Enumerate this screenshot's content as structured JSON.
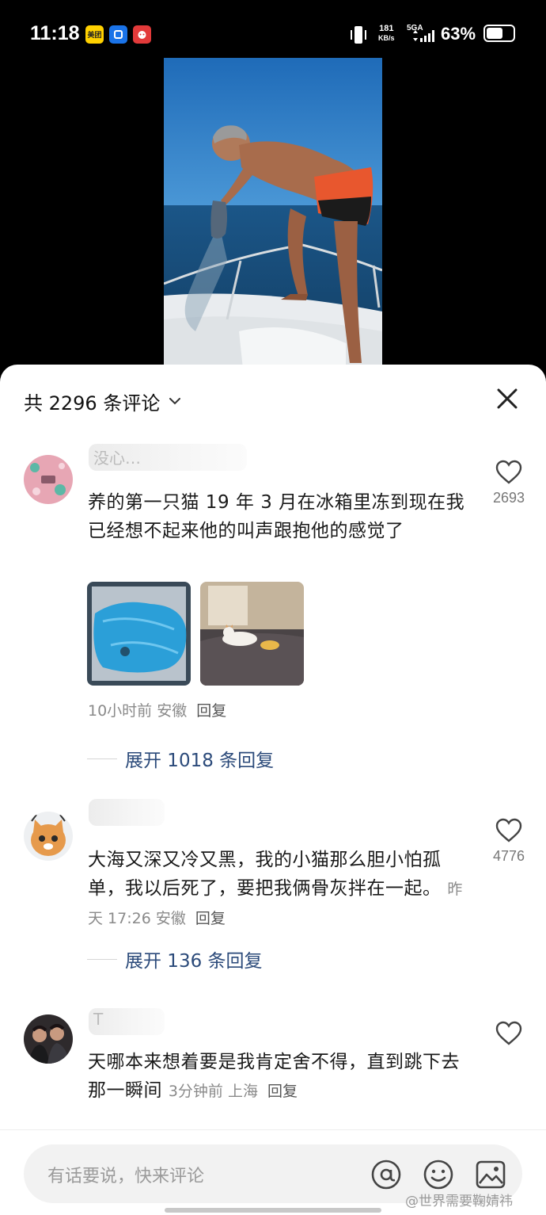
{
  "status_bar": {
    "time": "11:18",
    "app_badges": [
      "美团",
      "",
      ""
    ],
    "net_speed_value": "181",
    "net_speed_unit": "KB/s",
    "net_type": "5GA",
    "battery": "63%",
    "battery_level": 0.63
  },
  "sheet": {
    "title": "共 2296 条评论"
  },
  "comments": [
    {
      "username": "没心…",
      "text": "养的第一只猫 19 年 3 月在冰箱里冻到现在我已经想不起来他的叫声跟抱他的感觉了",
      "time": "10小时前",
      "location": "安徽",
      "reply_label": "回复",
      "likes": "2693",
      "expand_label": "展开 1018 条回复"
    },
    {
      "username": "",
      "text": "大海又深又冷又黑，我的小猫那么胆小怕孤单，我以后死了，要把我俩骨灰拌在一起。",
      "time": "昨天 17:26",
      "location": "安徽",
      "reply_label": "回复",
      "likes": "4776",
      "expand_label": "展开 136 条回复"
    },
    {
      "username": "T",
      "text": "天哪本来想着要是我肯定舍不得，直到跳下去那一瞬间",
      "time": "3分钟前",
      "location": "上海",
      "reply_label": "回复",
      "likes": ""
    }
  ],
  "input": {
    "placeholder": "有话要说，快来评论"
  },
  "watermark": "@世界需要鞠婧祎",
  "colors": {
    "link_blue": "#2b4a7a",
    "sheet_bg": "#ffffff",
    "sky": "#1f6bb8",
    "sea": "#174a75"
  }
}
